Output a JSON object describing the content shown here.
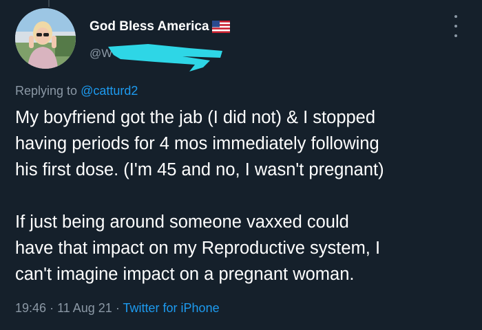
{
  "tweet": {
    "display_name": "God Bless America",
    "flag_emoji_name": "us-flag-icon",
    "handle_visible": "@W",
    "reply_prefix": "Replying to",
    "reply_to": "@catturd2",
    "body_paragraphs": [
      "My boyfriend got the jab (I did not) & I stopped\nhaving periods for 4 mos immediately following\nhis first dose. (I'm 45 and no, I wasn't pregnant)",
      "If just being around someone vaxxed could\nhave that impact on my Reproductive system, I\ncan't imagine impact on a pregnant woman."
    ],
    "time": "19:46",
    "date": "11 Aug 21",
    "separator": "·",
    "source": "Twitter for iPhone"
  },
  "colors": {
    "background": "#15202b",
    "text_primary": "#ffffff",
    "text_secondary": "#8b98a5",
    "link": "#1d9bf0",
    "redaction": "#2ed6e6"
  }
}
